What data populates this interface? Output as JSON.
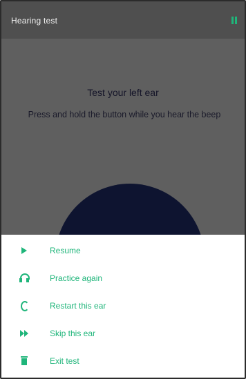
{
  "header": {
    "title": "Hearing test",
    "pause_icon": "pause-icon"
  },
  "test": {
    "heading": "Test your left ear",
    "instructions": "Press and hold the button while you hear the beep"
  },
  "menu": {
    "items": [
      {
        "label": "Resume",
        "icon": "play-icon"
      },
      {
        "label": "Practice again",
        "icon": "headphones-icon"
      },
      {
        "label": "Restart this ear",
        "icon": "ear-icon"
      },
      {
        "label": "Skip this ear",
        "icon": "skip-icon"
      },
      {
        "label": "Exit test",
        "icon": "trash-icon"
      }
    ]
  },
  "colors": {
    "accent": "#1fb57a",
    "overlay": "#5f5f5f",
    "button": "#0e1430"
  }
}
